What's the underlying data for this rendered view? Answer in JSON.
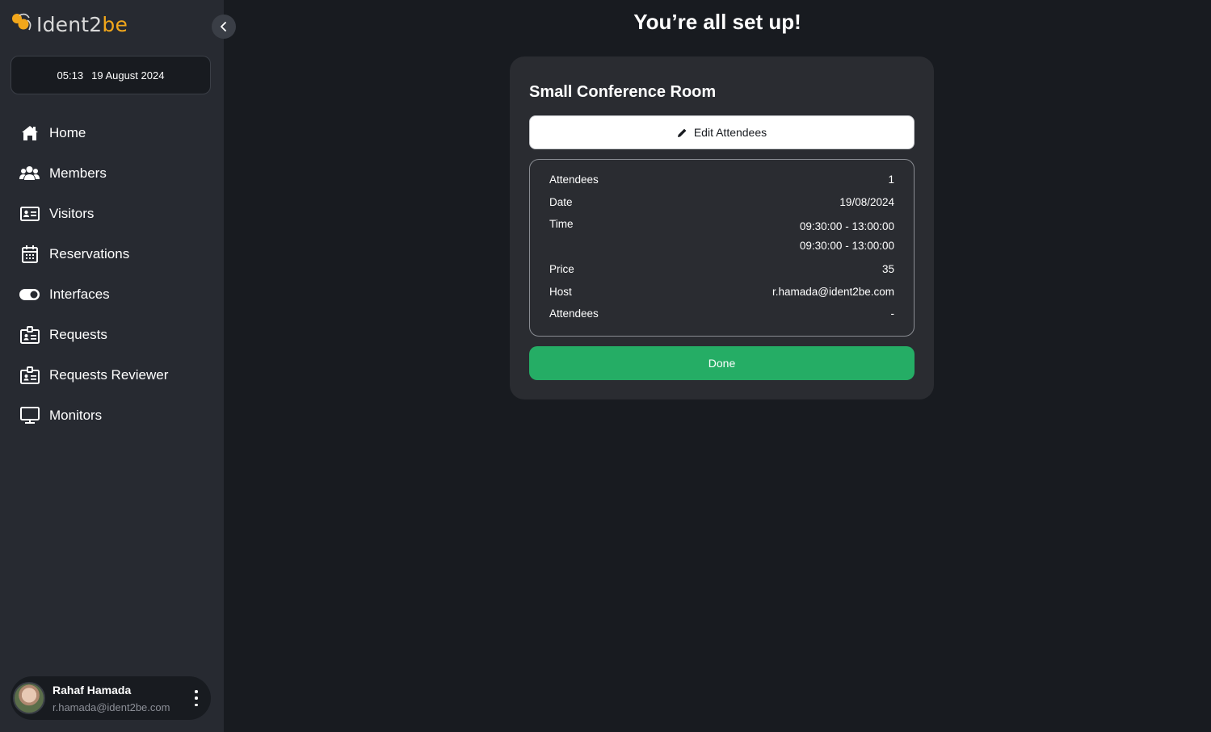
{
  "app": {
    "logo_prefix": "Ident2",
    "logo_accent": "be",
    "brand_color": "#f2a71b"
  },
  "sidebar": {
    "time": "05:13",
    "date": "19 August 2024",
    "items": [
      {
        "label": "Home",
        "icon": "home-icon"
      },
      {
        "label": "Members",
        "icon": "members-icon"
      },
      {
        "label": "Visitors",
        "icon": "id-card-icon"
      },
      {
        "label": "Reservations",
        "icon": "calendar-icon"
      },
      {
        "label": "Interfaces",
        "icon": "toggle-icon"
      },
      {
        "label": "Requests",
        "icon": "badge-icon"
      },
      {
        "label": "Requests Reviewer",
        "icon": "badge-icon"
      },
      {
        "label": "Monitors",
        "icon": "monitor-icon"
      }
    ],
    "user": {
      "name": "Rahaf Hamada",
      "email": "r.hamada@ident2be.com"
    }
  },
  "main": {
    "title": "You’re all set up!",
    "card": {
      "room_name": "Small Conference Room",
      "edit_label": "Edit Attendees",
      "details": {
        "attendees_label": "Attendees",
        "attendees_value": "1",
        "date_label": "Date",
        "date_value": "19/08/2024",
        "time_label": "Time",
        "time_values": [
          "09:30:00 - 13:00:00",
          "09:30:00 - 13:00:00"
        ],
        "price_label": "Price",
        "price_value": "35",
        "host_label": "Host",
        "host_value": "r.hamada@ident2be.com",
        "attendees2_label": "Attendees",
        "attendees2_value": "-"
      },
      "done_label": "Done",
      "done_color": "#25ad65"
    }
  }
}
